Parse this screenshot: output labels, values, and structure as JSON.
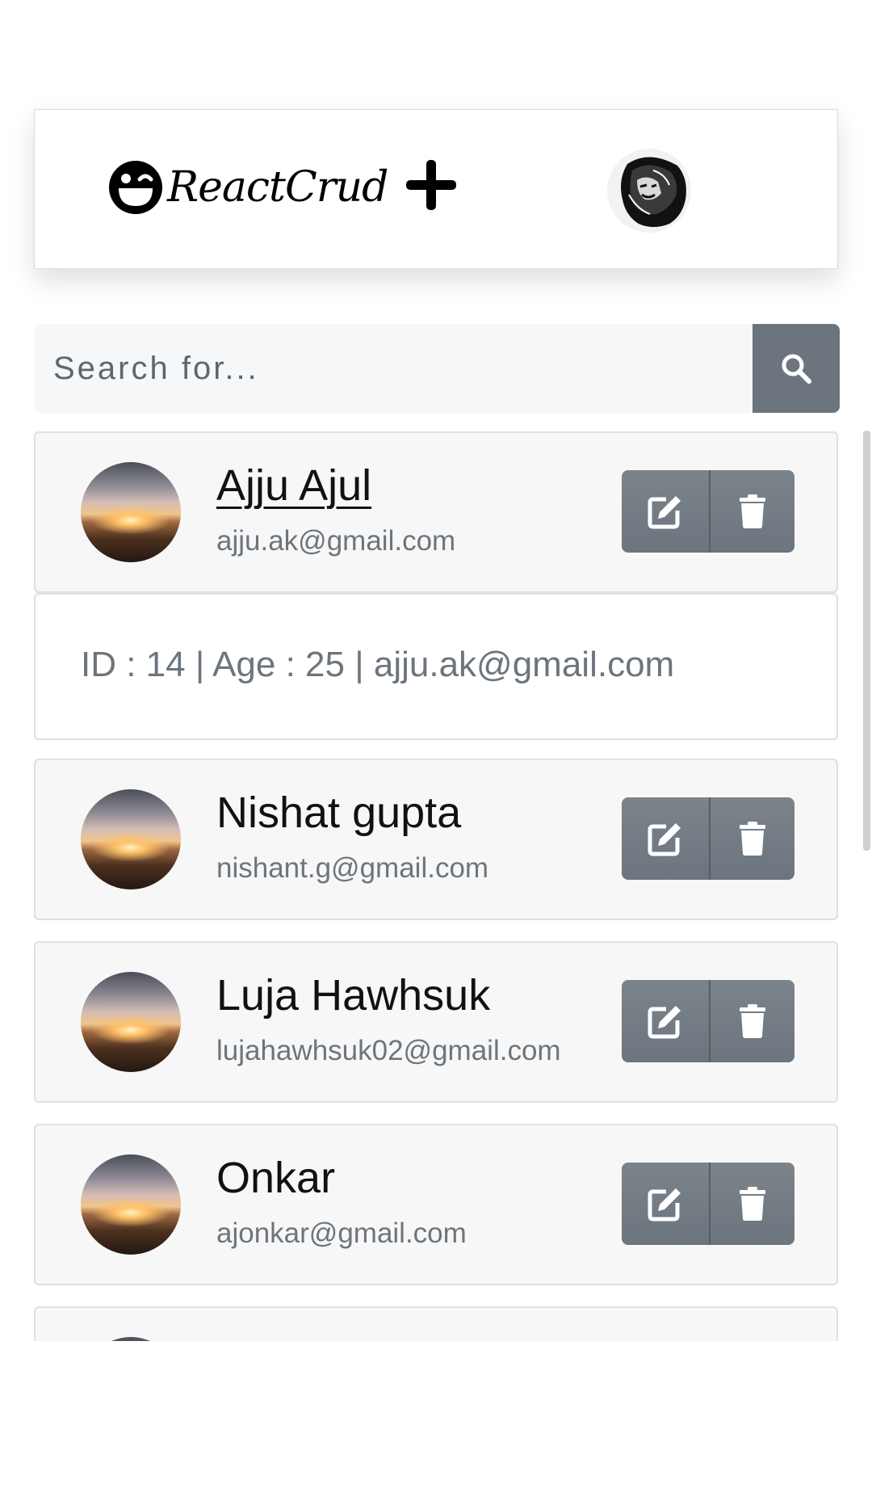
{
  "header": {
    "brand_text": "ReactCrud",
    "brand_icon": "smiley-wink-icon",
    "add_icon": "plus-icon",
    "logo_icon": "lion-logo"
  },
  "search": {
    "placeholder": "Search for...",
    "button_icon": "search-icon"
  },
  "users": [
    {
      "name": "Ajju Ajul",
      "email": "ajju.ak@gmail.com",
      "expanded": true,
      "details": "ID : 14 | Age : 25 | ajju.ak@gmail.com"
    },
    {
      "name": "Nishat gupta",
      "email": "nishant.g@gmail.com"
    },
    {
      "name": "Luja Hawhsuk",
      "email": "lujahawhsuk02@gmail.com"
    },
    {
      "name": "Onkar",
      "email": "ajonkar@gmail.com"
    },
    {
      "name": "",
      "email": ""
    }
  ],
  "colors": {
    "button_gray": "#6c757d",
    "card_bg": "#f7f7f7",
    "search_bg": "#f5f7f9"
  }
}
